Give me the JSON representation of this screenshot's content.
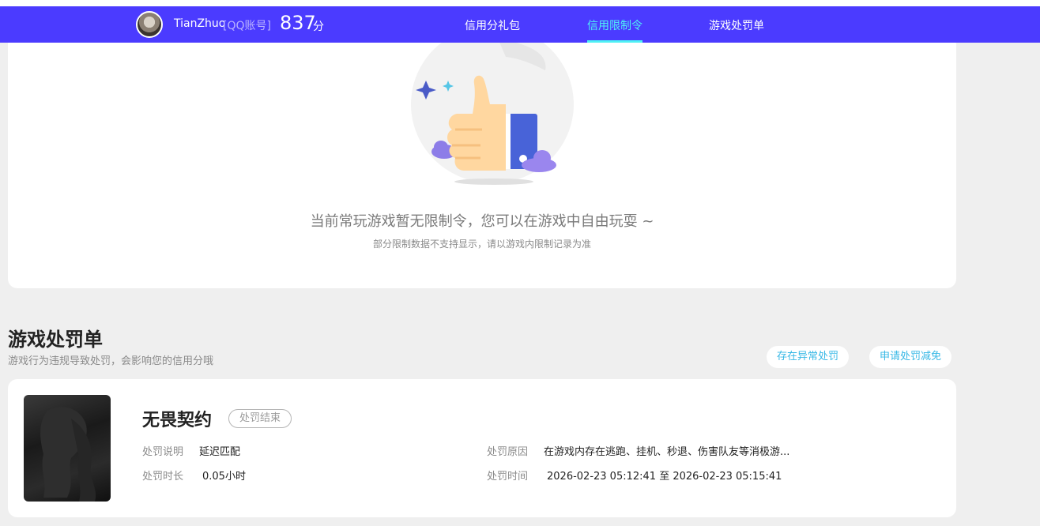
{
  "header": {
    "username": "TianZhuo",
    "account_type": "[QQ账号]",
    "score": "837",
    "score_unit": "分",
    "nav": [
      {
        "label": "信用分礼包"
      },
      {
        "label": "信用限制令"
      },
      {
        "label": "游戏处罚单"
      }
    ]
  },
  "restriction": {
    "empty_title": "当前常玩游戏暂无限制令，您可以在游戏中自由玩耍 ~",
    "empty_subtitle": "部分限制数据不支持显示，请以游戏内限制记录为准"
  },
  "penalty_section": {
    "title": "游戏处罚单",
    "subtitle": "游戏行为违规导致处罚，会影响您的信用分哦",
    "buttons": {
      "report_abnormal": "存在异常处罚",
      "apply_reduction": "申请处罚减免"
    }
  },
  "penalty": {
    "game_name": "无畏契约",
    "status": "处罚结束",
    "desc_label": "处罚说明",
    "desc_value": "延迟匹配",
    "duration_label": "处罚时长",
    "duration_value": "0.05小时",
    "reason_label": "处罚原因",
    "reason_value": "在游戏内存在逃跑、挂机、秒退、伤害队友等消极游...",
    "time_label": "处罚时间",
    "time_value": "2026-02-23 05:12:41 至 2026-02-23 05:15:41"
  },
  "colors": {
    "nav_bg": "#4b3bff",
    "nav_active": "#4ff1f5",
    "link": "#37b8e6"
  }
}
